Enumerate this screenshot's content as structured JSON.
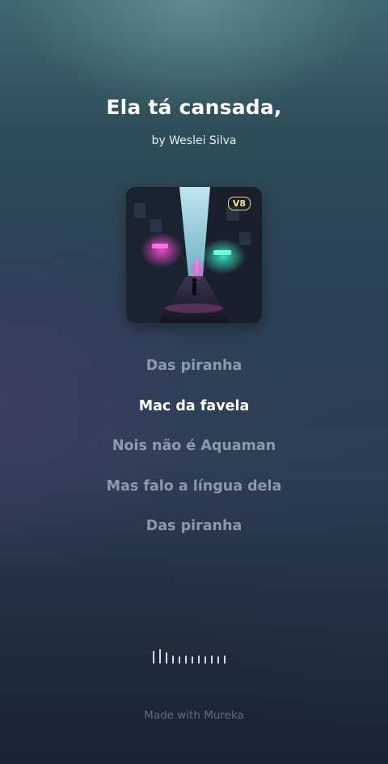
{
  "song": {
    "title": "Ela tá cansada,",
    "artist_line": "by Weslei Silva",
    "version_badge": "V8"
  },
  "lyrics": [
    {
      "text": "Das piranha",
      "active": false
    },
    {
      "text": "Mac da favela",
      "active": true
    },
    {
      "text": "Nois não é Aquaman",
      "active": false
    },
    {
      "text": "Mas falo a língua dela",
      "active": false
    },
    {
      "text": "Das piranha",
      "active": false
    }
  ],
  "footer": {
    "label": "Made with Mureka"
  },
  "colors": {
    "accent_badge": "#e7d97a",
    "active_lyric": "#ffffff",
    "inactive_lyric": "#c8d4e0"
  }
}
